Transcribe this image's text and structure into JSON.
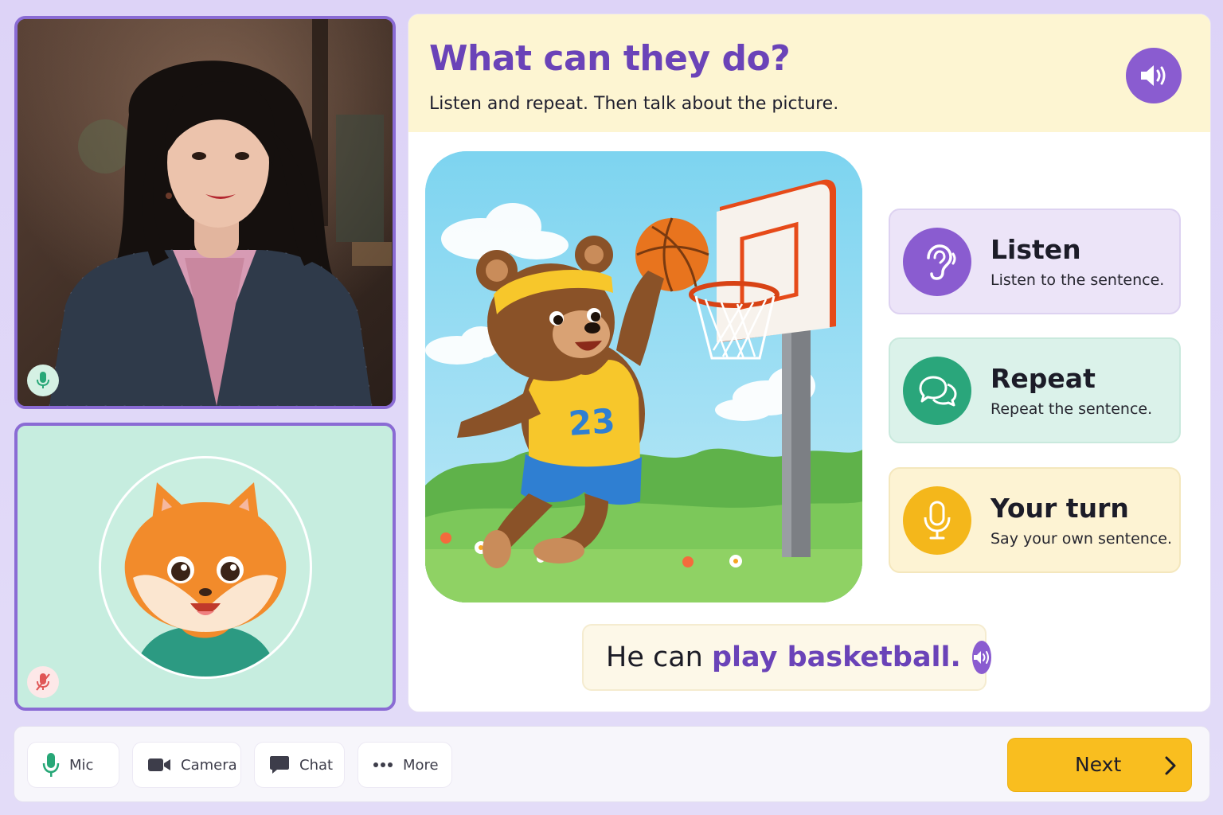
{
  "participants": {
    "teacher": {
      "mic": "mic-on-icon"
    },
    "student": {
      "avatar": "fox-avatar",
      "mic": "mic-off-icon"
    }
  },
  "lesson": {
    "title": "What can they do?",
    "subtitle": "Listen and repeat. Then talk about the picture.",
    "header_audio_icon": "speaker-icon",
    "picture": {
      "description_icon": "bear-basketball-illustration",
      "jersey_number": "23"
    },
    "steps": [
      {
        "title": "Listen",
        "description": "Listen to the sentence.",
        "icon": "ear-icon",
        "color": "#8a5cd0"
      },
      {
        "title": "Repeat",
        "description": "Repeat the sentence.",
        "icon": "chat-bubbles-icon",
        "color": "#2aa67b"
      },
      {
        "title": "Your turn",
        "description": "Say your own sentence.",
        "icon": "microphone-icon",
        "color": "#f4b71b"
      }
    ],
    "sentence": {
      "prefix": "He can ",
      "highlight": "play basketball.",
      "audio_icon": "speaker-icon"
    }
  },
  "toolbar": {
    "mic_label": "Mic",
    "camera_label": "Camera",
    "chat_label": "Chat",
    "more_label": "More",
    "next_label": "Next"
  },
  "colors": {
    "accent": "#6a43b8",
    "next_button": "#f9be1f",
    "background": "#ddd3f7"
  }
}
